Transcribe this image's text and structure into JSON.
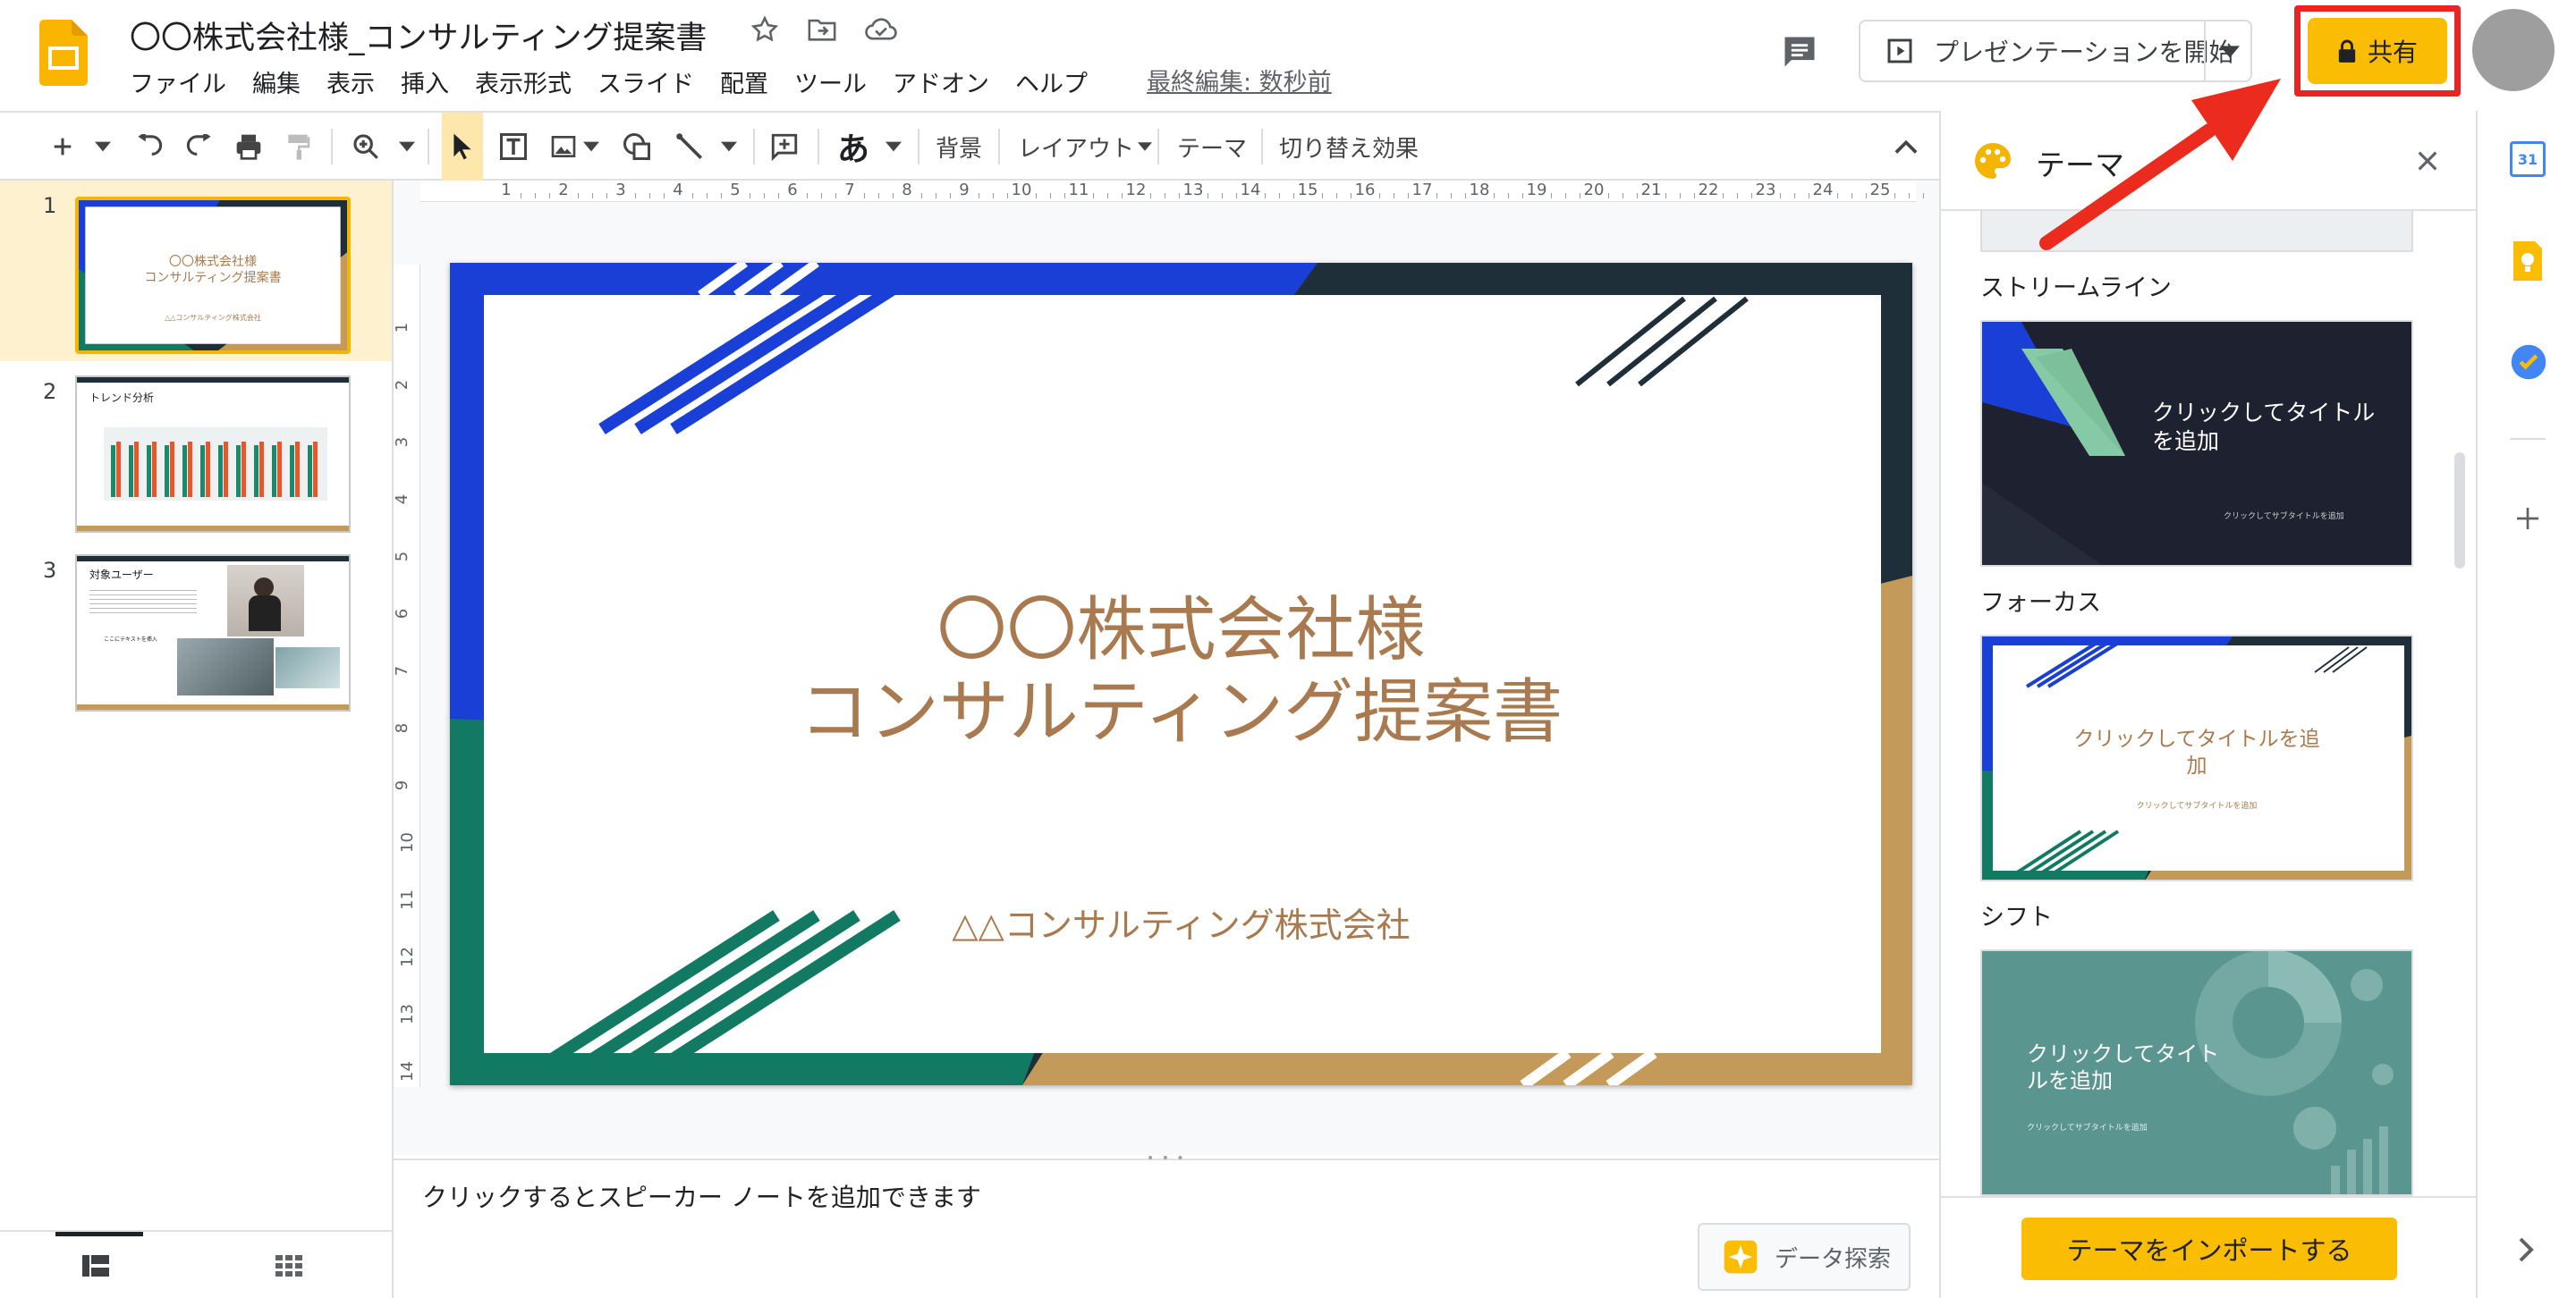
{
  "doc": {
    "title": "〇〇株式会社様_コンサルティング提案書",
    "last_edit": "最終編集: 数秒前"
  },
  "menu": [
    "ファイル",
    "編集",
    "表示",
    "挿入",
    "表示形式",
    "スライド",
    "配置",
    "ツール",
    "アドオン",
    "ヘルプ"
  ],
  "header": {
    "present_label": "プレゼンテーションを開始",
    "share_label": "共有"
  },
  "toolbar": {
    "font_label": "あ",
    "background": "背景",
    "layout": "レイアウト",
    "theme": "テーマ",
    "transition": "切り替え効果"
  },
  "ruler": {
    "h": [
      "1",
      "2",
      "3",
      "4",
      "5",
      "6",
      "7",
      "8",
      "9",
      "10",
      "11",
      "12",
      "13",
      "14",
      "15",
      "16",
      "17",
      "18",
      "19",
      "20",
      "21",
      "22",
      "23",
      "24",
      "25"
    ],
    "v": [
      "1",
      "2",
      "3",
      "4",
      "5",
      "6",
      "7",
      "8",
      "9",
      "10",
      "11",
      "12",
      "13",
      "14"
    ]
  },
  "slides": [
    {
      "num": "1",
      "title_line1": "〇〇株式会社様",
      "title_line2": "コンサルティング提案書",
      "sub": "△△コンサルティング株式会社"
    },
    {
      "num": "2",
      "title": "トレンド分析"
    },
    {
      "num": "3",
      "title": "対象ユーザー",
      "item": "ここにテキストを挿入"
    }
  ],
  "current_slide": {
    "title_line1": "〇〇株式会社様",
    "title_line2": "コンサルティング提案書",
    "subtitle": "△△コンサルティング株式会社"
  },
  "notes": {
    "placeholder": "クリックするとスピーカー ノートを追加できます",
    "explore_label": "データ探索"
  },
  "theme_panel": {
    "title": "テーマ",
    "themes": [
      {
        "name": "ストリームライン"
      },
      {
        "name": "フォーカス",
        "preview_title": "クリックしてタイトルを追加",
        "preview_sub": "クリックしてサブタイトルを追加"
      },
      {
        "name": "シフト",
        "preview_title": "クリックしてタイトルを追加",
        "preview_sub": "クリックしてサブタイトルを追加"
      },
      {
        "name": "",
        "preview_title": "クリックしてタイトルを追加",
        "preview_sub": "クリックしてサブタイトルを追加"
      }
    ],
    "import_label": "テーマをインポートする"
  },
  "side_rail": {
    "calendar_day": "31"
  },
  "colors": {
    "accent_yellow": "#fbbc04",
    "highlight_red": "#ea2323",
    "slide_blue": "#1a3fd6",
    "slide_green": "#127a63",
    "slide_gold": "#c49a5b",
    "slide_dark": "#1f2f3a",
    "title_brown": "#a97a4f"
  }
}
